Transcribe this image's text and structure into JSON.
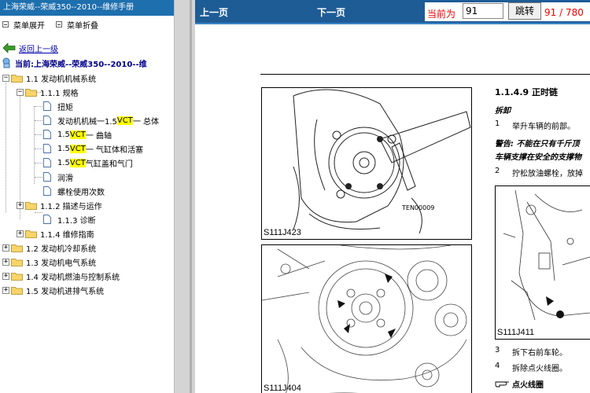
{
  "left_panel": {
    "title": "上海荣威--荣威350--2010--维修手册",
    "menu_expand": "菜单展开",
    "menu_collapse": "菜单折叠",
    "back_link": "返回上一级",
    "current": "当前:上海荣威--荣威350--2010--维",
    "tree": {
      "n1_1": "1.1 发动机机械系统",
      "n1_1_1": "1.1.1 规格",
      "leaf_torque": "扭矩",
      "leaf_overall_pre": "发动机机械一1.5",
      "leaf_overall_hl": "VCT",
      "leaf_overall_post": "一 总体",
      "leaf_crank_pre": "1.5",
      "leaf_crank_hl": "VCT",
      "leaf_crank_post": "一 曲轴",
      "leaf_block_pre": "1.5",
      "leaf_block_hl": "VCT",
      "leaf_block_post": "一 气缸体和活塞",
      "leaf_head_pre": "1.5",
      "leaf_head_hl": "VCT",
      "leaf_head_post": " 气缸盖和气门",
      "leaf_lube": "润滑",
      "leaf_bolt": "螺栓使用次数",
      "n1_1_2": "1.1.2 描述与运作",
      "n1_1_3": "1.1.3 诊断",
      "n1_1_4": "1.1.4 维修指南",
      "n1_2": "1.2 发动机冷却系统",
      "n1_3": "1.3 发动机电气系统",
      "n1_4": "1.4 发动机燃油与控制系统",
      "n1_5": "1.5 发动机进排气系统"
    },
    "highlight_color": "#ffff00",
    "title_bg": "#1e6fae"
  },
  "toolbar": {
    "prev": "上一页",
    "next": "下一页",
    "current_label": "当前为",
    "page_value": "91",
    "jump": "跳转",
    "page_count": "91 / 780",
    "bg": "#1e5c96"
  },
  "document": {
    "section_title": "1.1.4.9 正时链",
    "remove_heading": "拆卸",
    "step1_num": "1",
    "step1": "举升车辆的前部。",
    "warning1": "警告: 不能在只有千斤顶",
    "warning2": "车辆支撑在安全的支撑物",
    "step2_num": "2",
    "step2": "拧松放油螺栓，放掉",
    "fig1_caption": "S111J423",
    "fig1_label": "TEN00009",
    "fig2_caption": "S111J404",
    "fig3_caption": "S111J411",
    "step3_num": "3",
    "step3": "拆下右前车轮。",
    "step4_num": "4",
    "step4": "拆除点火线圈。",
    "ignition_heading": "点火线圈"
  }
}
